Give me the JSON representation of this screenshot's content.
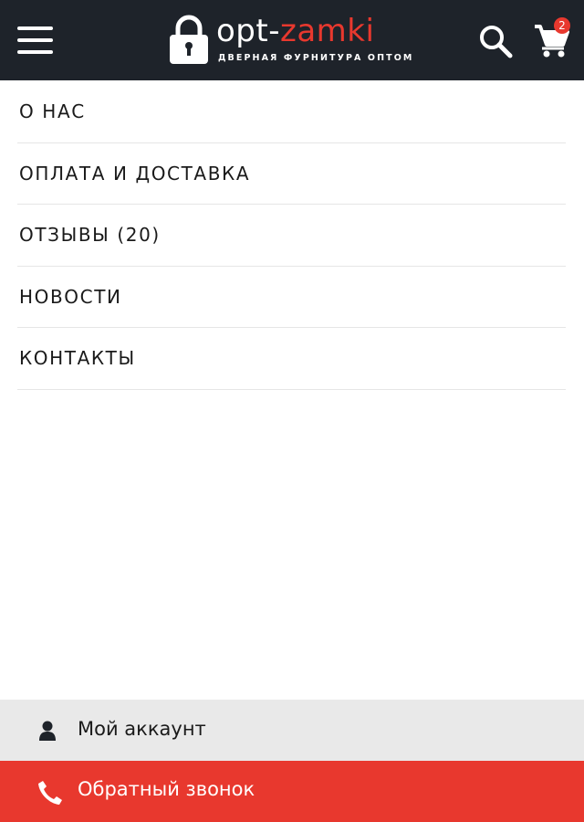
{
  "header": {
    "logo": {
      "brand_part1": "opt-",
      "brand_part2": "zamki",
      "tagline": "ДВЕРНАЯ ФУРНИТУРА ОПТОМ"
    },
    "menu_icon": "hamburger-icon",
    "search_icon": "search-icon",
    "cart_icon": "cart-icon",
    "cart_count": "2"
  },
  "menu": {
    "items": [
      {
        "label": "О НАС"
      },
      {
        "label": "ОПЛАТА И ДОСТАВКА"
      },
      {
        "label": "ОТЗЫВЫ (20)"
      },
      {
        "label": "НОВОСТИ"
      },
      {
        "label": "КОНТАКТЫ"
      }
    ]
  },
  "footer": {
    "account": {
      "label": "Мой аккаунт",
      "icon": "user-icon"
    },
    "callback": {
      "label": "Обратный звонок",
      "icon": "phone-icon"
    }
  },
  "colors": {
    "header_bg": "#1e232a",
    "accent": "#e8382e",
    "account_bg": "#e9e9e9"
  }
}
